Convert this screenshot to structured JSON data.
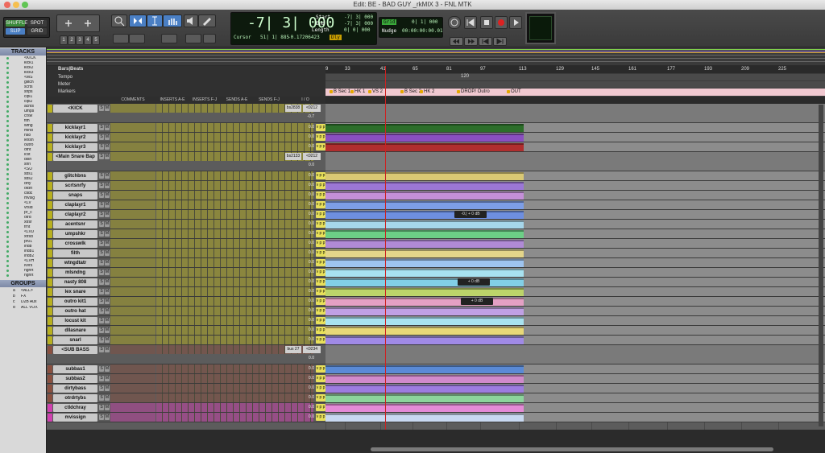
{
  "window": {
    "title": "Edit: BE - BAD GUY _rkMIX 3 - FNL MTK"
  },
  "toolbar": {
    "modes": [
      "SHUFFLE",
      "SPOT",
      "SLIP",
      "GRID"
    ],
    "zoom_presets": [
      "1",
      "2",
      "3",
      "4",
      "5"
    ],
    "main_counter": "-7| 3| 000",
    "cursor_label": "Cursor",
    "cursor_value": "51| 1| 885",
    "cursor_readout": "-0.17206423",
    "start_label": "Start",
    "end_label": "End",
    "length_label": "Length",
    "start_value": "-7| 3| 000",
    "end_value": "-7| 3| 000",
    "length_value": "0| 0| 000",
    "grid_label": "Grid",
    "grid_value": "0| 1| 000",
    "nudge_label": "Nudge",
    "nudge_value": "00:00:00:00.01",
    "dly_label": "Dly"
  },
  "tracks_panel": {
    "header": "TRACKS",
    "items": [
      "<KICK",
      "kick1",
      "kick2",
      "kick3",
      "<MS",
      "glitch",
      "scrts",
      "snps",
      "clpl1",
      "clpl2",
      "acnts",
      "umps",
      "crsw",
      "flth",
      "wtng",
      "mlnd",
      "ns8",
      "lexsn",
      "outro",
      "otht",
      "lcst",
      "dlsn",
      "snrl",
      "<SU",
      "sbs1",
      "sbs2",
      "drty",
      "otdrt",
      "ctldc",
      "mvsig",
      "<LV",
      "vrsld",
      "pr_c",
      "otrd",
      "xtrsf",
      "frnt",
      "<LVD",
      "xtrsd",
      "pr01",
      "lndb",
      "lndb1",
      "lndb2",
      "<LVH",
      "lvvrs",
      "hghrt",
      "hghrt"
    ]
  },
  "groups_panel": {
    "header": "GROUPS",
    "items": [
      {
        "id": "a",
        "name": "<ALL>"
      },
      {
        "id": "b",
        "name": "FX"
      },
      {
        "id": "c",
        "name": "D2B Aux"
      },
      {
        "id": "d",
        "name": "ALL VOX"
      }
    ]
  },
  "ruler": {
    "labels": [
      "Bars|Beats",
      "Tempo",
      "Meter",
      "Markers"
    ],
    "bars": [
      "9",
      "33",
      "41",
      "65",
      "81",
      "97",
      "113",
      "129",
      "145",
      "161",
      "177",
      "193",
      "209",
      "225"
    ],
    "tempo": "120",
    "markers": [
      "B Sec 1",
      "HK 1",
      "VS 2",
      "B Sec 2",
      "HK 2",
      "DROP/ Outro",
      "OUT"
    ]
  },
  "columns": [
    "COMMENTS",
    "INSERTS A-E",
    "INSERTS F-J",
    "SENDS A-E",
    "SENDS F-J",
    "I / O"
  ],
  "tracks": [
    {
      "name": "<KICK",
      "type": "folder",
      "color": "#b8b020",
      "io": "bs2838",
      "out": "<0212",
      "vol": "-0.7"
    },
    {
      "name": "kicklayr1",
      "type": "audio",
      "color": "#b8b020",
      "vol": "0.0",
      "clip": "#2c6e2a"
    },
    {
      "name": "kicklayr2",
      "type": "audio",
      "color": "#b8b020",
      "vol": "0.0",
      "clip": "#8a4fc0"
    },
    {
      "name": "kicklayr3",
      "type": "audio",
      "color": "#b8b020",
      "vol": "0.0",
      "clip": "#b02e2e"
    },
    {
      "name": "<Main Snare Bap",
      "type": "folder",
      "color": "#b8b020",
      "io": "bs2133",
      "out": "<0212",
      "vol": "0.0"
    },
    {
      "name": "glitchbns",
      "type": "audio",
      "color": "#b8b020",
      "vol": "0.0",
      "clip": "#d9c874"
    },
    {
      "name": "scrtsnrfy",
      "type": "audio",
      "color": "#b8b020",
      "vol": "0.0",
      "clip": "#9b77d6"
    },
    {
      "name": "snaps",
      "type": "audio",
      "color": "#b8b020",
      "vol": "0.0",
      "clip": "#c48fd8"
    },
    {
      "name": "claplayr1",
      "type": "audio",
      "color": "#b8b020",
      "vol": "0.0",
      "clip": "#7d9ee6"
    },
    {
      "name": "claplayr2",
      "type": "audio",
      "color": "#b8b020",
      "vol": "0.0",
      "clip": "#6e8fe0"
    },
    {
      "name": "acentsnr",
      "type": "audio",
      "color": "#b8b020",
      "vol": "0.0",
      "clip": "#a6d6ea"
    },
    {
      "name": "umpshkr",
      "type": "audio",
      "color": "#b8b020",
      "vol": "0.0",
      "clip": "#6ccf86"
    },
    {
      "name": "crosswlk",
      "type": "audio",
      "color": "#b8b020",
      "vol": "0.0",
      "clip": "#b08ad6"
    },
    {
      "name": "filth",
      "type": "audio",
      "color": "#b8b020",
      "vol": "0.0",
      "clip": "#e4d58a"
    },
    {
      "name": "wtngdtatr",
      "type": "audio",
      "color": "#b8b020",
      "vol": "0.0",
      "clip": "#9ec4ef"
    },
    {
      "name": "mlsndng",
      "type": "audio",
      "color": "#b8b020",
      "vol": "0.0",
      "clip": "#a8e2f0"
    },
    {
      "name": "nasty 808",
      "type": "audio",
      "color": "#b8b020",
      "vol": "0.0",
      "clip": "#82cfe6"
    },
    {
      "name": "lex snare",
      "type": "audio",
      "color": "#b8b020",
      "vol": "0.0",
      "clip": "#bcd46a"
    },
    {
      "name": "outro kit1",
      "type": "audio",
      "color": "#b8b020",
      "vol": "0.0",
      "clip": "#e4a0c4"
    },
    {
      "name": "outro hat",
      "type": "audio",
      "color": "#b8b020",
      "vol": "0.0",
      "clip": "#c0a0e4"
    },
    {
      "name": "locust kit",
      "type": "audio",
      "color": "#b8b020",
      "vol": "0.0",
      "clip": "#a8e2f0"
    },
    {
      "name": "dllasnare",
      "type": "audio",
      "color": "#b8b020",
      "vol": "0.0",
      "clip": "#e8d878"
    },
    {
      "name": "snarl",
      "type": "audio",
      "color": "#b8b020",
      "vol": "0.0",
      "clip": "#a08ae6"
    },
    {
      "name": "<SUB BASS",
      "type": "folder",
      "color": "#8a5040",
      "io": "bus 27",
      "out": "<0234",
      "vol": "0.0"
    },
    {
      "name": "subbas1",
      "type": "audio",
      "color": "#8a5040",
      "vol": "0.0",
      "clip": "#5a8ad6"
    },
    {
      "name": "subbas2",
      "type": "audio",
      "color": "#8a5040",
      "vol": "0.0",
      "clip": "#d08acb"
    },
    {
      "name": "dirtybass",
      "type": "audio",
      "color": "#8a5040",
      "vol": "0.0",
      "clip": "#9d7ce0"
    },
    {
      "name": "otrdrtybs",
      "type": "audio",
      "color": "#8a5040",
      "vol": "0.0",
      "clip": "#8cd49c"
    },
    {
      "name": "ctldchray",
      "type": "audio",
      "color": "#d040b0",
      "vol": "0.0",
      "clip": "#e48ad6"
    },
    {
      "name": "mvissign",
      "type": "audio",
      "color": "#d040b0",
      "vol": "0.0",
      "clip": "#c8d8f0"
    }
  ],
  "gain_badges": [
    "-0.| + 0 dB",
    "+ 0 dB",
    "+ 0 dB"
  ],
  "colors": {
    "accent": "#4a7fc4",
    "record": "#d22",
    "solo_yellow": "#e8e05a"
  }
}
